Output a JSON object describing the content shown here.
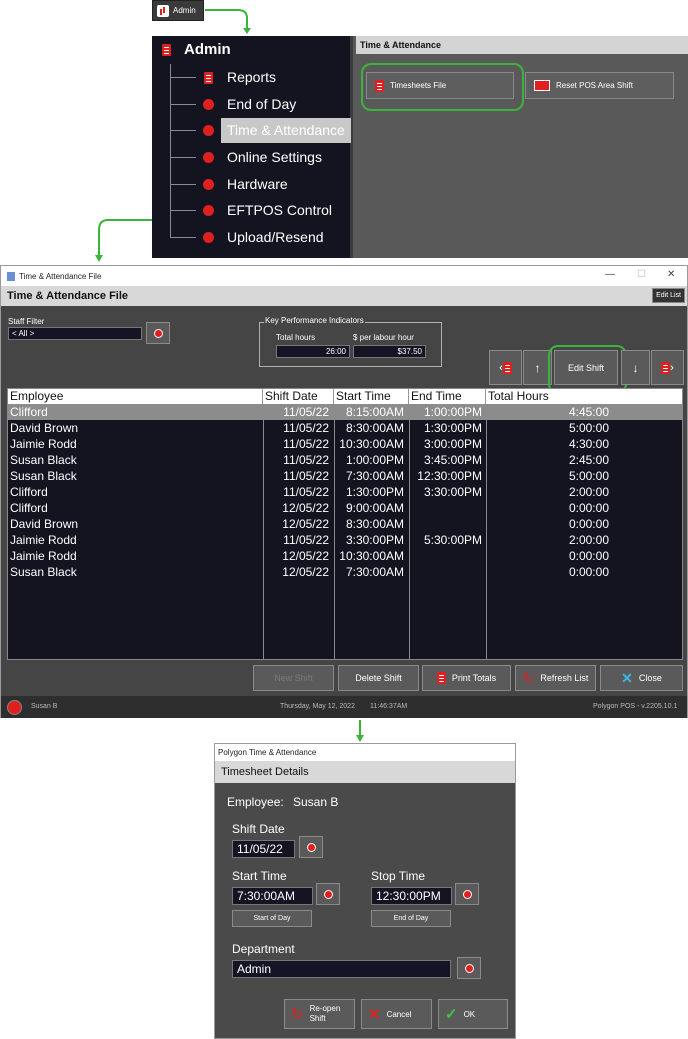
{
  "admin_chip": {
    "label": "Admin"
  },
  "admin_menu": {
    "title": "Admin",
    "items": [
      {
        "label": "Reports"
      },
      {
        "label": "End of Day"
      },
      {
        "label": "Time & Attendance"
      },
      {
        "label": "Online Settings"
      },
      {
        "label": "Hardware"
      },
      {
        "label": "EFTPOS Control"
      },
      {
        "label": "Upload/Resend"
      }
    ]
  },
  "ta_area": {
    "header": "Time & Attendance",
    "timesheets_btn": "Timesheets File",
    "reset_btn": "Reset POS Area Shift"
  },
  "main_window": {
    "title": "Time & Attendance File",
    "header": "Time & Attendance File",
    "edit_list": "Edit List",
    "staff_filter_label": "Staff Filter",
    "staff_filter_value": "< All >",
    "kpi": {
      "legend": "Key Performance Indicators",
      "total_hours_label": "Total hours",
      "total_hours_value": "26:00",
      "per_labour_label": "$ per labour hour",
      "per_labour_value": "$37.50"
    },
    "edit_shift": "Edit Shift",
    "columns": [
      "Employee",
      "Shift Date",
      "Start Time",
      "End Time",
      "Total Hours"
    ],
    "rows": [
      {
        "employee": "Clifford",
        "date": "11/05/22",
        "start": "8:15:00AM",
        "end": "1:00:00PM",
        "total": "4:45:00"
      },
      {
        "employee": "David Brown",
        "date": "11/05/22",
        "start": "8:30:00AM",
        "end": "1:30:00PM",
        "total": "5:00:00"
      },
      {
        "employee": "Jaimie Rodd",
        "date": "11/05/22",
        "start": "10:30:00AM",
        "end": "3:00:00PM",
        "total": "4:30:00"
      },
      {
        "employee": "Susan Black",
        "date": "11/05/22",
        "start": "1:00:00PM",
        "end": "3:45:00PM",
        "total": "2:45:00"
      },
      {
        "employee": "Susan Black",
        "date": "11/05/22",
        "start": "7:30:00AM",
        "end": "12:30:00PM",
        "total": "5:00:00"
      },
      {
        "employee": "Clifford",
        "date": "11/05/22",
        "start": "1:30:00PM",
        "end": "3:30:00PM",
        "total": "2:00:00"
      },
      {
        "employee": "Clifford",
        "date": "12/05/22",
        "start": "9:00:00AM",
        "end": "",
        "total": "0:00:00"
      },
      {
        "employee": "David Brown",
        "date": "12/05/22",
        "start": "8:30:00AM",
        "end": "",
        "total": "0:00:00"
      },
      {
        "employee": "Jaimie Rodd",
        "date": "11/05/22",
        "start": "3:30:00PM",
        "end": "5:30:00PM",
        "total": "2:00:00"
      },
      {
        "employee": "Jaimie Rodd",
        "date": "12/05/22",
        "start": "10:30:00AM",
        "end": "",
        "total": "0:00:00"
      },
      {
        "employee": "Susan Black",
        "date": "12/05/22",
        "start": "7:30:00AM",
        "end": "",
        "total": "0:00:00"
      }
    ],
    "buttons": {
      "new_shift": "New Shift",
      "delete_shift": "Delete Shift",
      "print_totals": "Print Totals",
      "refresh_list": "Refresh List",
      "close": "Close"
    },
    "status": {
      "user": "Susan B",
      "date": "Thursday, May 12, 2022",
      "time": "11:46:37AM",
      "version": "Polygon POS - v.2205.10.1"
    }
  },
  "dialog": {
    "title": "Polygon Time & Attendance",
    "header": "Timesheet Details",
    "employee_label": "Employee:",
    "employee_value": "Susan B",
    "shift_date_label": "Shift Date",
    "shift_date_value": "11/05/22",
    "start_time_label": "Start Time",
    "start_time_value": "7:30:00AM",
    "start_of_day": "Start of Day",
    "stop_time_label": "Stop Time",
    "stop_time_value": "12:30:00PM",
    "end_of_day": "End of Day",
    "department_label": "Department",
    "department_value": "Admin",
    "reopen_line1": "Re-open",
    "reopen_line2": "Shift",
    "cancel": "Cancel",
    "ok": "OK"
  },
  "colors": {
    "accent_red": "#e0201e",
    "highlight_green": "#3cb43c",
    "dark_bg": "#141420",
    "panel_grey": "#454545"
  }
}
